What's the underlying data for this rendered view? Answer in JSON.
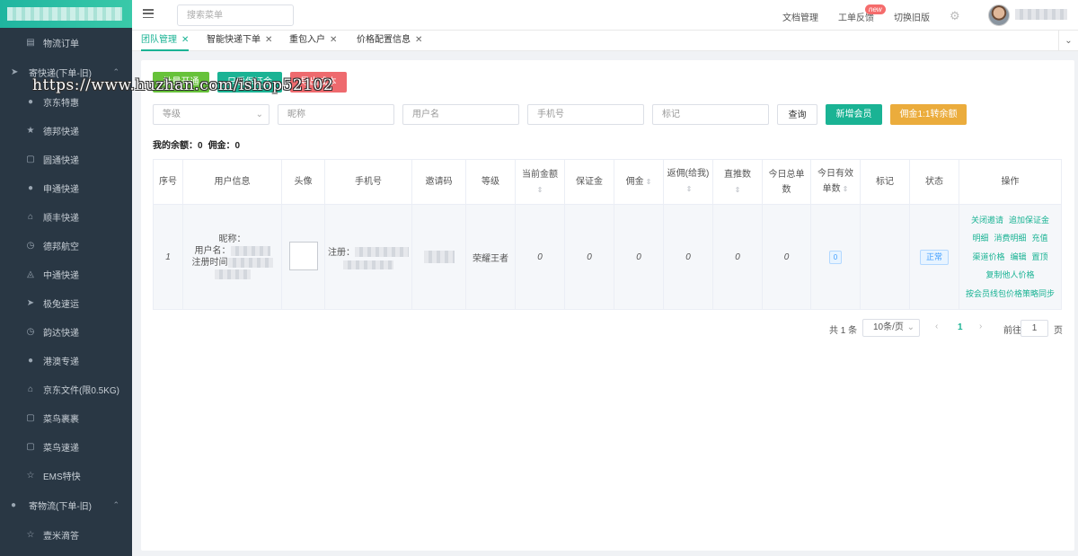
{
  "sidebar": {
    "items": [
      {
        "label": "物流订单",
        "icon": "document-icon"
      },
      {
        "group": true,
        "label": "寄快递(下单-旧)",
        "icon": "send-icon"
      },
      {
        "label": "京东特惠",
        "icon": "location-icon"
      },
      {
        "label": "德邦快递",
        "icon": "star-icon"
      },
      {
        "label": "圆通快递",
        "icon": "lock-icon"
      },
      {
        "label": "申通快递",
        "icon": "location-icon"
      },
      {
        "label": "顺丰快递",
        "icon": "home-icon"
      },
      {
        "label": "德邦航空",
        "icon": "clock-icon"
      },
      {
        "label": "中通快递",
        "icon": "bell-icon"
      },
      {
        "label": "极兔速运",
        "icon": "send-icon"
      },
      {
        "label": "韵达快递",
        "icon": "clock-icon"
      },
      {
        "label": "港澳专递",
        "icon": "location-icon"
      },
      {
        "label": "京东文件(限0.5KG)",
        "icon": "home-icon"
      },
      {
        "label": "菜鸟裹裹",
        "icon": "lock-icon"
      },
      {
        "label": "菜鸟速递",
        "icon": "lock-icon"
      },
      {
        "label": "EMS特快",
        "icon": "star-outline-icon"
      },
      {
        "group": true,
        "label": "寄物流(下单-旧)",
        "icon": "location-icon"
      },
      {
        "label": "壹米滴答",
        "icon": "star-outline-icon"
      }
    ]
  },
  "header": {
    "search_placeholder": "搜索菜单",
    "doc_link": "文档管理",
    "ticket_link": "工单反馈",
    "ticket_badge": "new",
    "switch_link": "切换旧版"
  },
  "tabs": [
    {
      "label": "团队管理",
      "active": true
    },
    {
      "label": "智能快递下单",
      "active": false
    },
    {
      "label": "重包入户",
      "active": false
    },
    {
      "label": "价格配置信息",
      "active": false
    }
  ],
  "actions": {
    "btn1": "批量开通",
    "btn2": "只看保证金",
    "btn3": "导出成本"
  },
  "filters": {
    "level": "等级",
    "nickname": "昵称",
    "username": "用户名",
    "phone": "手机号",
    "mark": "标记",
    "query": "查询",
    "add_member": "新增会员",
    "commission_to_balance": "佣金1:1转余额"
  },
  "balance": {
    "balance_label": "我的余额：0",
    "commission_label": "佣金：0"
  },
  "table": {
    "headers": [
      "序号",
      "用户信息",
      "头像",
      "手机号",
      "邀请码",
      "等级",
      "当前金额",
      "保证金",
      "佣金",
      "返佣(给我)",
      "直推数",
      "今日总单数",
      "今日有效单数",
      "标记",
      "状态",
      "操作"
    ],
    "row": {
      "index": "1",
      "nickname_label": "昵称：",
      "username_label": "用户名：",
      "register_label": "注册时间",
      "phone_label": "注册：",
      "level": "荣耀王者",
      "current_amount": "0",
      "deposit": "0",
      "commission": "0",
      "rebate": "0",
      "direct_count": "0",
      "today_total": "0",
      "today_valid": "0",
      "status": "正常",
      "ops": [
        [
          "关闭邀请",
          "追加保证金"
        ],
        [
          "明细",
          "消费明细",
          "充值"
        ],
        [
          "渠道价格",
          "编辑",
          "置顶"
        ],
        [
          "复制他人价格"
        ],
        [
          "按会员线包价格策略同步"
        ]
      ]
    }
  },
  "pagination": {
    "total": "共 1 条",
    "page_size": "10条/页",
    "prev": "‹",
    "current": "1",
    "next": "›",
    "goto_label": "前往",
    "goto_value": "1",
    "page_unit": "页"
  },
  "watermark": "https://www.huzhan.com/ishop52102"
}
